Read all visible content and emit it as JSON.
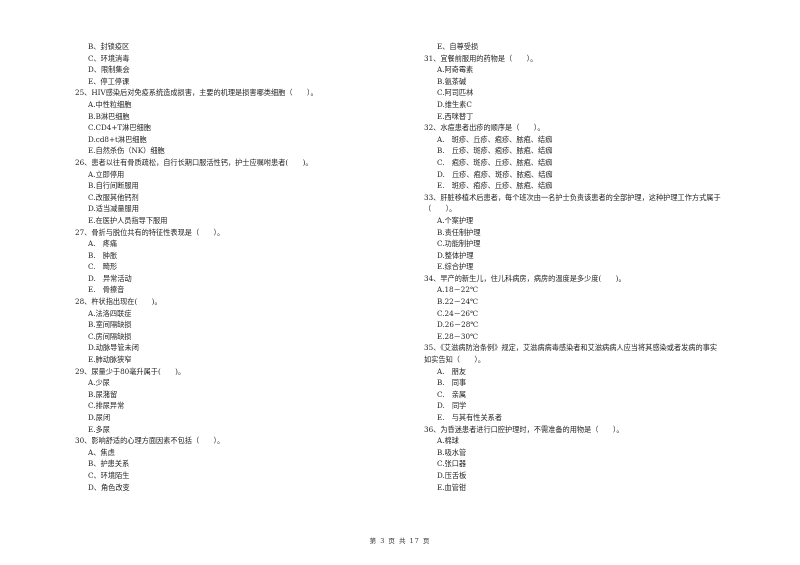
{
  "left_column": [
    {
      "type": "opt",
      "text": "B、封锁疫区"
    },
    {
      "type": "opt",
      "text": "C、环境消毒"
    },
    {
      "type": "opt",
      "text": "D、限制集会"
    },
    {
      "type": "opt",
      "text": "E、停工停课"
    },
    {
      "type": "q",
      "text": "25、HIV感染后对免疫系统造成损害，主要的机理是损害哪类细胞（　　）。"
    },
    {
      "type": "opt",
      "text": "A.中性粒细胞"
    },
    {
      "type": "opt",
      "text": "B.B淋巴细胞"
    },
    {
      "type": "opt",
      "text": "C.CD4+T淋巴细胞"
    },
    {
      "type": "opt",
      "text": "D.cd8+t淋巴细胞"
    },
    {
      "type": "opt",
      "text": "E.自然杀伤（NK）细胞"
    },
    {
      "type": "q",
      "text": "26、患者以往有骨质疏松，自行长期口服活性钙，护士应嘱咐患者(　　)。"
    },
    {
      "type": "opt",
      "text": "A.立即停用"
    },
    {
      "type": "opt",
      "text": "B.自行间断服用"
    },
    {
      "type": "opt",
      "text": "C.改服其他钙剂"
    },
    {
      "type": "opt",
      "text": "D.适当减量服用"
    },
    {
      "type": "opt",
      "text": "E.在医护人员指导下服用"
    },
    {
      "type": "q",
      "text": "27、骨折与脱位共有的特征性表现是（　　）。"
    },
    {
      "type": "opt",
      "text": "A.　疼痛"
    },
    {
      "type": "opt",
      "text": "B.　肿胀"
    },
    {
      "type": "opt",
      "text": "C.　畸形"
    },
    {
      "type": "opt",
      "text": "D.　异常活动"
    },
    {
      "type": "opt",
      "text": "E.　骨擦音"
    },
    {
      "type": "q",
      "text": "28、杵状指出现在(　　)。"
    },
    {
      "type": "opt",
      "text": "A.法洛四联症"
    },
    {
      "type": "opt",
      "text": "B.室间隔缺损"
    },
    {
      "type": "opt",
      "text": "C.房间隔缺损"
    },
    {
      "type": "opt",
      "text": "D.动脉导管未闭"
    },
    {
      "type": "opt",
      "text": "E.肺动脉狭窄"
    },
    {
      "type": "q",
      "text": "29、尿量少于80毫升属于(　　)。"
    },
    {
      "type": "opt",
      "text": "A.少尿"
    },
    {
      "type": "opt",
      "text": "B.尿潴留"
    },
    {
      "type": "opt",
      "text": "C.排尿异常"
    },
    {
      "type": "opt",
      "text": "D.尿闭"
    },
    {
      "type": "opt",
      "text": "E.多尿"
    },
    {
      "type": "q",
      "text": "30、影响舒适的心理方面因素不包括（　　）。"
    },
    {
      "type": "opt",
      "text": "A、焦虑"
    },
    {
      "type": "opt",
      "text": "B、护患关系"
    },
    {
      "type": "opt",
      "text": "C、环境陌生"
    },
    {
      "type": "opt",
      "text": "D、角色改变"
    }
  ],
  "right_column": [
    {
      "type": "opt",
      "text": "E、自尊受损"
    },
    {
      "type": "q",
      "text": "31、宜餐前服用的药物是（　　）。"
    },
    {
      "type": "opt",
      "text": "A.阿奇霉素"
    },
    {
      "type": "opt",
      "text": "B.氨茶碱"
    },
    {
      "type": "opt",
      "text": "C.阿司匹林"
    },
    {
      "type": "opt",
      "text": "D.维生素C"
    },
    {
      "type": "opt",
      "text": "E.西咪替丁"
    },
    {
      "type": "q",
      "text": "32、水痘患者出疹的顺序是（　　）。"
    },
    {
      "type": "opt",
      "text": "A.　斑疹、丘疹、疱疹、脓疱、结痂"
    },
    {
      "type": "opt",
      "text": "B.　丘疹、斑疹、疱疹、脓疱、结痂"
    },
    {
      "type": "opt",
      "text": "C.　疱疹、斑疹、丘疹、脓疱、结痂"
    },
    {
      "type": "opt",
      "text": "D.　丘疹、疱疹、斑疹、脓疱、结痂"
    },
    {
      "type": "opt",
      "text": "E.　斑疹、疱疹、丘疹、脓疱、结痂"
    },
    {
      "type": "q",
      "text": "33、肝脏移植术后患者，每个班次由一名护士负责该患者的全部护理，这种护理工作方式属于"
    },
    {
      "type": "q",
      "text": "（　　）。"
    },
    {
      "type": "opt",
      "text": "A.个案护理"
    },
    {
      "type": "opt",
      "text": "B.责任制护理"
    },
    {
      "type": "opt",
      "text": "C.功能制护理"
    },
    {
      "type": "opt",
      "text": "D.整体护理"
    },
    {
      "type": "opt",
      "text": "E.综合护理"
    },
    {
      "type": "q",
      "text": "34、早产的新生儿，住儿科病房，病房的温度是多少度(　　)。"
    },
    {
      "type": "opt",
      "text": "A.18－22℃"
    },
    {
      "type": "opt",
      "text": "B.22－24℃"
    },
    {
      "type": "opt",
      "text": "C.24－26℃"
    },
    {
      "type": "opt",
      "text": "D.26－28℃"
    },
    {
      "type": "opt",
      "text": "E.28－30℃"
    },
    {
      "type": "q",
      "text": "35、《艾滋病防治条例》规定，艾滋病病毒感染者和艾滋病病人应当将其感染或者发病的事实"
    },
    {
      "type": "q",
      "text": "如实告知（　　）。"
    },
    {
      "type": "opt",
      "text": "A.　朋友"
    },
    {
      "type": "opt",
      "text": "B.　同事"
    },
    {
      "type": "opt",
      "text": "C.　亲属"
    },
    {
      "type": "opt",
      "text": "D.　同学"
    },
    {
      "type": "opt",
      "text": "E.　与其有性关系者"
    },
    {
      "type": "q",
      "text": "36、为昏迷患者进行口腔护理时，不需准备的用物是（　　）。"
    },
    {
      "type": "opt",
      "text": "A.棉球"
    },
    {
      "type": "opt",
      "text": "B.吸水管"
    },
    {
      "type": "opt",
      "text": "C.张口器"
    },
    {
      "type": "opt",
      "text": "D.压舌板"
    },
    {
      "type": "opt",
      "text": "E.血管钳"
    }
  ],
  "footer": {
    "page_label": "第 3 页 共 17 页"
  }
}
